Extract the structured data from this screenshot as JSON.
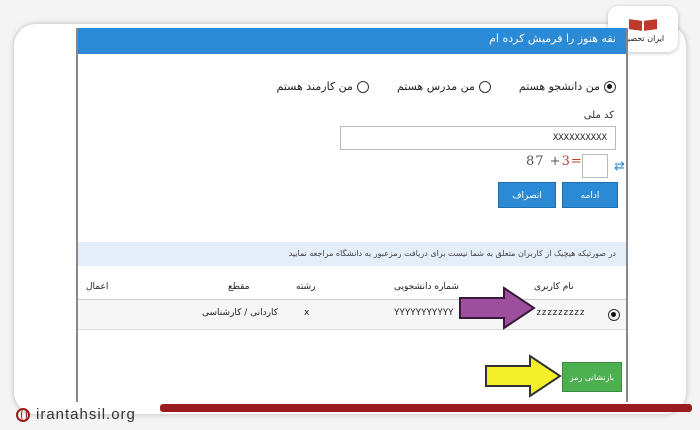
{
  "logo": {
    "text": "ایران تحصیل"
  },
  "site": {
    "label": "irantahsil.org"
  },
  "form": {
    "header": "نقه هنوز را فرمیش کرده ام",
    "radios": [
      {
        "label": "من دانشجو هستم",
        "checked": true
      },
      {
        "label": "من مدرس هستم",
        "checked": false
      },
      {
        "label": "من کارمند هستم",
        "checked": false
      }
    ],
    "code_label": "کد ملی",
    "code_value": "XXXXXXXXXX",
    "captcha_text": "87 +",
    "captcha_mark": "3=",
    "refresh_icon": "refresh-icon",
    "continue_label": "ادامه",
    "cancel_label": "انصراف"
  },
  "info": {
    "text": "در صورتیکه هیچیک از کاربران متعلق به شما نیست برای دریافت رمزعبور به دانشگاه مراجعه نمایید"
  },
  "table": {
    "headers": {
      "username": "نام کاربری",
      "student_no": "شماره دانشجویی",
      "field": "رشته",
      "level": "مقطع",
      "actions": "اعمال"
    },
    "rows": [
      {
        "username": "zzzzzzzzz",
        "student_no": "YYYYYYYYYYY",
        "field": "x",
        "level": "کاردانی / کارشناسی",
        "selected": true
      }
    ]
  },
  "reset_button": "بازنشانی رمز عبور",
  "colors": {
    "primary": "#2a8ad6",
    "success": "#4caf50",
    "arrow_purple": "#9b4f9c",
    "arrow_yellow": "#f3f02a",
    "brand_red": "#9b1c1c"
  }
}
